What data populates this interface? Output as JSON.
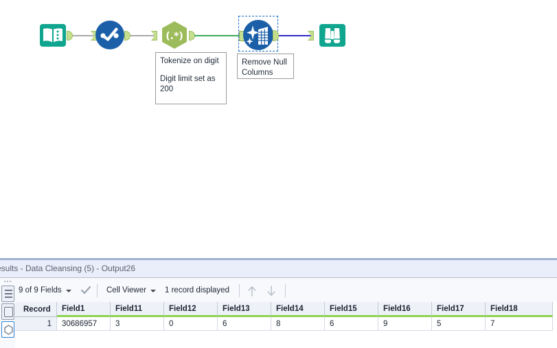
{
  "canvas": {
    "tools": [
      {
        "id": "input-data",
        "icon_name": "book-input-data-icon",
        "label": "",
        "color": "#00a38a"
      },
      {
        "id": "data-cleansing",
        "icon_name": "check-data-cleansing-icon",
        "label": "",
        "color": "#1b5fa8"
      },
      {
        "id": "regex",
        "icon_name": "regex-hexagon-icon",
        "label": "(.*)",
        "color": "#9cbb5a"
      },
      {
        "id": "remove-null-macro",
        "icon_name": "sparkle-grid-macro-icon",
        "label": "",
        "color": "#1b5fa8"
      },
      {
        "id": "browse",
        "icon_name": "binoculars-browse-icon",
        "label": "",
        "color": "#00a38a"
      }
    ],
    "annotations": [
      {
        "id": "regex-annotation",
        "line1": "Tokenize on digit",
        "line2": "Digit limit set as",
        "line3": "200"
      },
      {
        "id": "macro-annotation",
        "line1": "Remove Null",
        "line2": "Columns",
        "line3": ""
      }
    ],
    "wire_colors": {
      "gray": "#a8a8a8",
      "green": "#3aa85a",
      "blue": "#2b2bc8"
    }
  },
  "results": {
    "title": "esults - Data Cleansing (5) - Output26",
    "toolbar": {
      "fields_label": "9 of 9 Fields",
      "check_icon": "checkmark-icon",
      "view_mode_label": "Cell Viewer",
      "record_count_label": "1 record displayed",
      "prev_icon": "arrow-up-icon",
      "next_icon": "arrow-down-icon"
    },
    "side_strip": {
      "grip_icon": "drag-grip-dots-icon",
      "buttons": [
        {
          "id": "list-view",
          "icon": "list-lines-icon",
          "selected": false
        },
        {
          "id": "profile-view",
          "icon": "rounded-rect-icon",
          "selected": false
        },
        {
          "id": "tool-hex",
          "icon": "hexagon-icon",
          "selected": true
        }
      ]
    },
    "table": {
      "columns": [
        "Record",
        "Field1",
        "Field11",
        "Field12",
        "Field13",
        "Field14",
        "Field15",
        "Field16",
        "Field17",
        "Field18"
      ],
      "rows": [
        [
          "1",
          "30686957",
          "3",
          "0",
          "6",
          "8",
          "6",
          "9",
          "5",
          "7"
        ]
      ]
    },
    "accent_colors": {
      "header_underline": "#8ed34f",
      "title_bar": "#9fb0d4",
      "pane_bg": "#f7f9fd"
    }
  }
}
